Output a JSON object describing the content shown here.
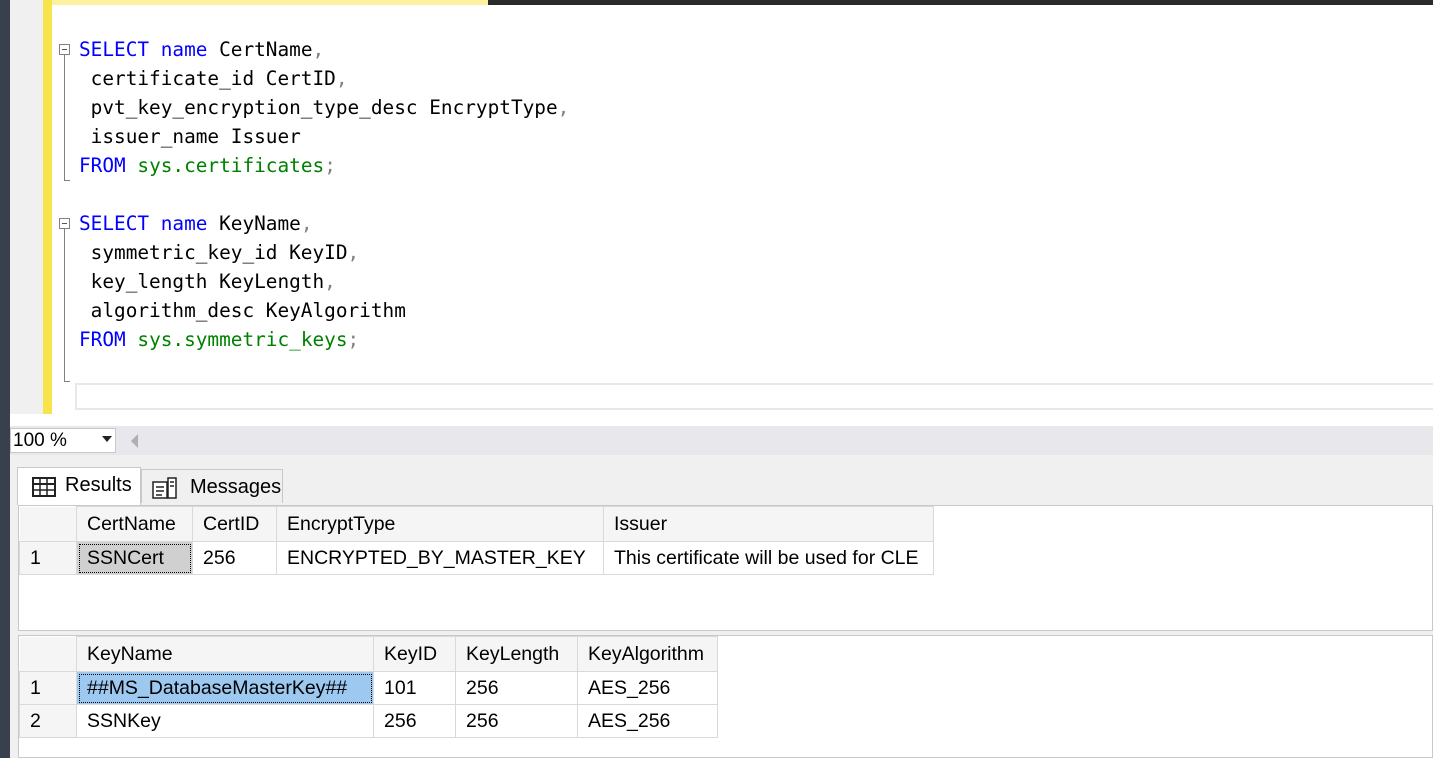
{
  "editor": {
    "lines": [
      [
        {
          "t": "SELECT",
          "c": "kw"
        },
        {
          "t": " "
        },
        {
          "t": "name",
          "c": "kw"
        },
        {
          "t": " CertName"
        },
        {
          "t": ",",
          "c": "punct"
        }
      ],
      [
        {
          "t": " certificate_id CertID"
        },
        {
          "t": ",",
          "c": "punct"
        }
      ],
      [
        {
          "t": " pvt_key_encryption_type_desc EncryptType"
        },
        {
          "t": ",",
          "c": "punct"
        }
      ],
      [
        {
          "t": " issuer_name Issuer"
        }
      ],
      [
        {
          "t": "FROM",
          "c": "kw"
        },
        {
          "t": " "
        },
        {
          "t": "sys.certificates",
          "c": "sysobj"
        },
        {
          "t": ";",
          "c": "punct"
        }
      ],
      [],
      [
        {
          "t": "SELECT",
          "c": "kw"
        },
        {
          "t": " "
        },
        {
          "t": "name",
          "c": "kw"
        },
        {
          "t": " KeyName"
        },
        {
          "t": ",",
          "c": "punct"
        }
      ],
      [
        {
          "t": " symmetric_key_id KeyID"
        },
        {
          "t": ",",
          "c": "punct"
        }
      ],
      [
        {
          "t": " key_length KeyLength"
        },
        {
          "t": ",",
          "c": "punct"
        }
      ],
      [
        {
          "t": " algorithm_desc KeyAlgorithm"
        }
      ],
      [
        {
          "t": "FROM",
          "c": "kw"
        },
        {
          "t": " "
        },
        {
          "t": "sys.symmetric_keys",
          "c": "sysobj"
        },
        {
          "t": ";",
          "c": "punct"
        }
      ]
    ]
  },
  "zoom": {
    "value": "100 %"
  },
  "tabs": {
    "results": "Results",
    "messages": "Messages"
  },
  "grid1": {
    "columns": [
      "CertName",
      "CertID",
      "EncryptType",
      "Issuer"
    ],
    "rows": [
      {
        "num": "1",
        "cells": [
          "SSNCert",
          "256",
          "ENCRYPTED_BY_MASTER_KEY",
          "This certificate will be used for CLE"
        ]
      }
    ]
  },
  "grid2": {
    "columns": [
      "KeyName",
      "KeyID",
      "KeyLength",
      "KeyAlgorithm"
    ],
    "rows": [
      {
        "num": "1",
        "cells": [
          "##MS_DatabaseMasterKey##",
          "101",
          "256",
          "AES_256"
        ]
      },
      {
        "num": "2",
        "cells": [
          "SSNKey",
          "256",
          "256",
          "AES_256"
        ]
      }
    ]
  }
}
